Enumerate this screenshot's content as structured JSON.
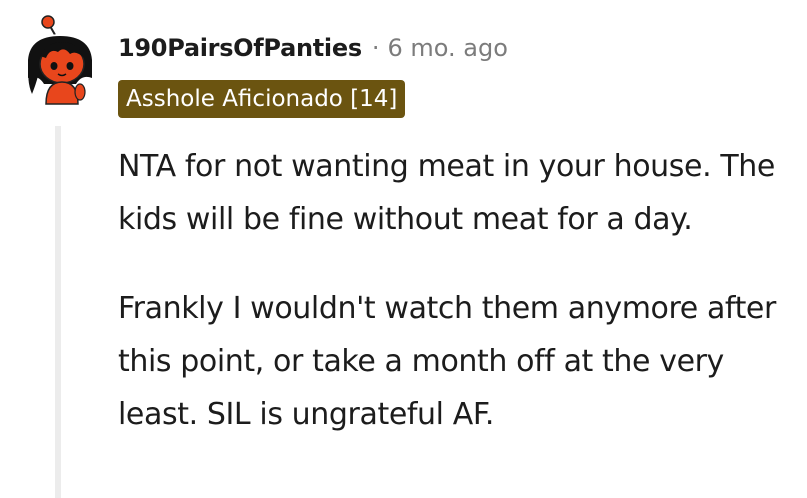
{
  "comment": {
    "username": "190PairsOfPanties",
    "separator": "·",
    "timestamp": "6 mo. ago",
    "flair": "Asshole Aficionado [14]",
    "avatar_icon": "snoo-avatar-icon",
    "paragraphs": [
      "NTA for not wanting meat in your house. The kids will be fine without meat for a day.",
      "Frankly I wouldn't watch them anymore after this point, or take a month off at the very least. SIL is ungrateful AF."
    ]
  },
  "colors": {
    "flair_bg": "#6b5410",
    "avatar_body": "#e8461c",
    "avatar_hair": "#111111",
    "thread_line": "#ececec",
    "meta_text": "#7c7c7c"
  }
}
